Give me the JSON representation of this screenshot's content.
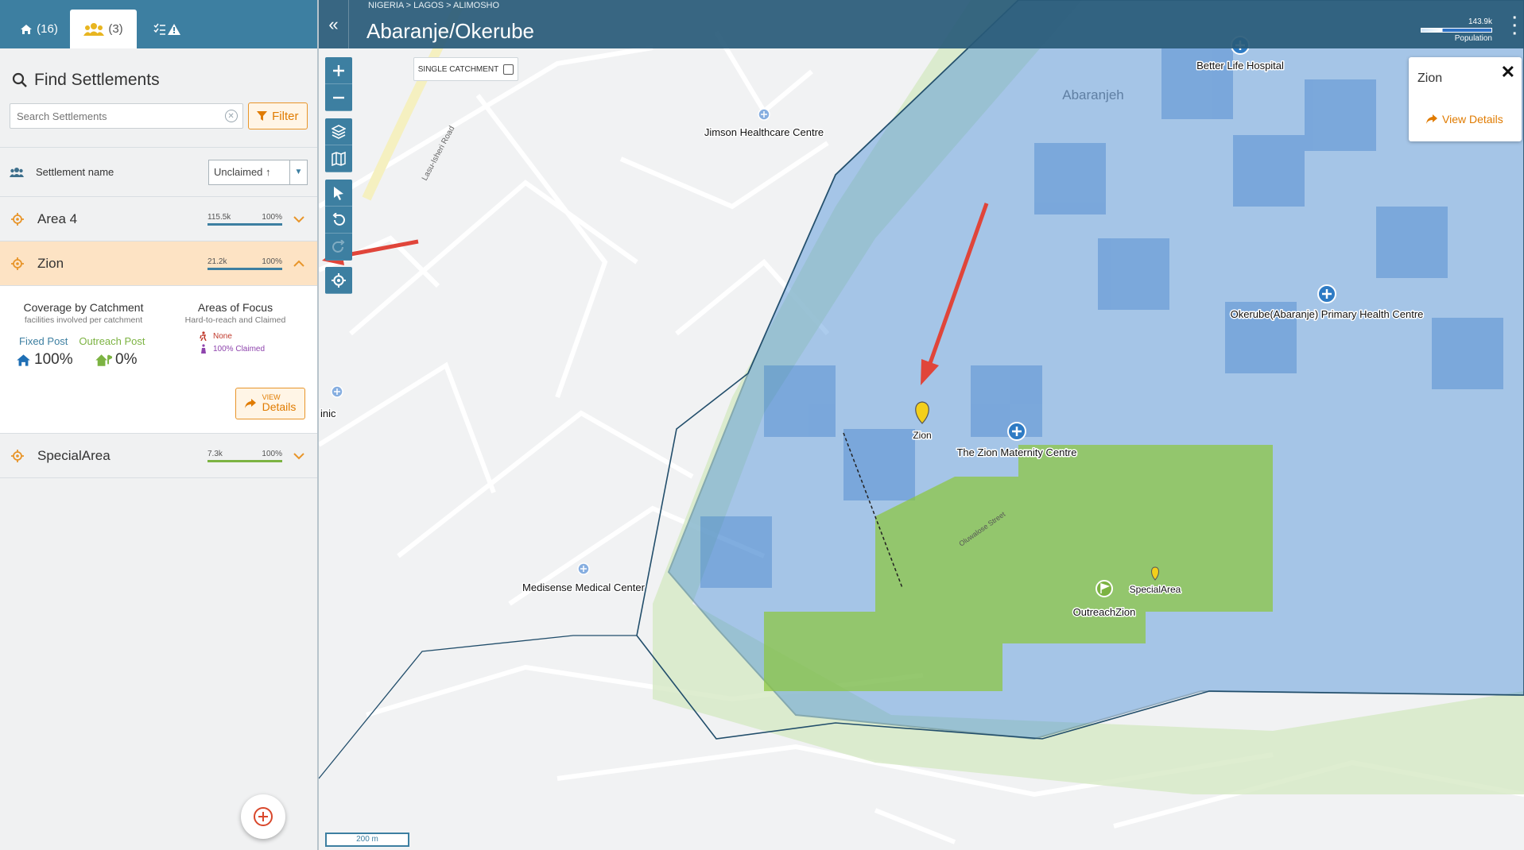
{
  "tabs": [
    {
      "label": "(16)",
      "icon": "house-icon"
    },
    {
      "label": "(3)",
      "icon": "people-icon"
    },
    {
      "label": "",
      "icon": "checklist-warning-icon"
    }
  ],
  "sidebar": {
    "title": "Find Settlements",
    "search_placeholder": "Search Settlements",
    "filter_label": "Filter",
    "list_header_label": "Settlement name",
    "sort_value": "Unclaimed ↑",
    "settlements": [
      {
        "name": "Area 4",
        "population": "115.5k",
        "coverage": "100%",
        "bar_color": "#3d7fa1"
      },
      {
        "name": "Zion",
        "population": "21.2k",
        "coverage": "100%",
        "bar_color": "#3d7fa1"
      },
      {
        "name": "SpecialArea",
        "population": "7.3k",
        "coverage": "100%",
        "bar_color": "#7cb342"
      }
    ],
    "details": {
      "coverage_title": "Coverage by Catchment",
      "coverage_sub": "facilities involved per catchment",
      "focus_title": "Areas of Focus",
      "focus_sub": "Hard-to-reach and Claimed",
      "focus_none": "None",
      "focus_claimed": "100% Claimed",
      "fixed_post_label": "Fixed Post",
      "outreach_post_label": "Outreach Post",
      "fixed_post_pct": "100%",
      "outreach_post_pct": "0%",
      "view_line1": "VIEW",
      "view_line2": "Details"
    }
  },
  "map": {
    "breadcrumb": "NIGERIA > LAGOS > ALIMOSHO",
    "title": "Abaranje/Okerube",
    "population_value": "143.9k",
    "population_label": "Population",
    "single_catchment_label": "SINGLE CATCHMENT",
    "scale_label": "200 m",
    "popup": {
      "title": "Zion",
      "view_details": "View Details"
    },
    "places": {
      "better_life": "Better Life Hospital",
      "jimson": "Jimson Healthcare Centre",
      "okerube": "Okerube(Abaranje) Primary Health Centre",
      "zion_maternity": "The Zion Maternity Centre",
      "medisense": "Medisense Medical Center",
      "clinic_partial": "inic",
      "zion": "Zion",
      "special_area": "SpecialArea",
      "outreach_zion": "OutreachZion",
      "abaranjeh": "Abaranjeh",
      "lasu_road": "Lasu-Isheri Road",
      "oluwalose": "Oluwalose Street"
    },
    "colors": {
      "catchment_blue": "#4a8fd9",
      "settlement_green": "#8cc63f",
      "accent_orange": "#e8952a",
      "header_blue": "#3d7fa1",
      "arrow_red": "#e0453a"
    }
  }
}
